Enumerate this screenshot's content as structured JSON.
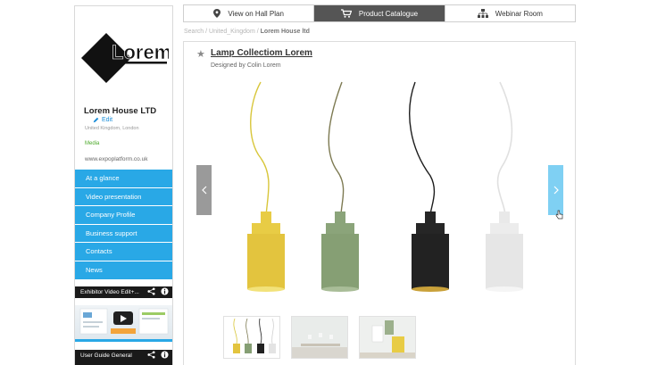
{
  "sidebar": {
    "company_name": "Lorem House LTD",
    "edit_label": "Edit",
    "location": "United Kingdom, London",
    "media_badge": "Media",
    "website": "www.expoplatform.co.uk",
    "logo_text": "Lorem",
    "nav": [
      {
        "label": "At a glance"
      },
      {
        "label": "Video presentation"
      },
      {
        "label": "Company Profile"
      },
      {
        "label": "Business support"
      },
      {
        "label": "Contacts"
      },
      {
        "label": "News"
      }
    ],
    "video_title": "Exhibitor Video Edit+...",
    "guide_title": "User Guide General"
  },
  "tabs": [
    {
      "label": "View on Hall Plan",
      "icon": "map-pin-icon",
      "active": false
    },
    {
      "label": "Product Catalogue",
      "icon": "cart-icon",
      "active": true
    },
    {
      "label": "Webinar Room",
      "icon": "sitemap-icon",
      "active": false
    }
  ],
  "breadcrumb": {
    "search": "Search",
    "country": "United_Kingdom",
    "current": "Lorem House ltd"
  },
  "product": {
    "title": "Lamp Collectiom Lorem",
    "designer": "Designed by Colin Lorem"
  },
  "colors": {
    "accent": "#29a8e6",
    "active_tab": "#555555",
    "lamp_yellow": "#e8cc45",
    "lamp_green": "#8ba47a",
    "lamp_black": "#262626",
    "lamp_white": "#e9e9e9"
  }
}
